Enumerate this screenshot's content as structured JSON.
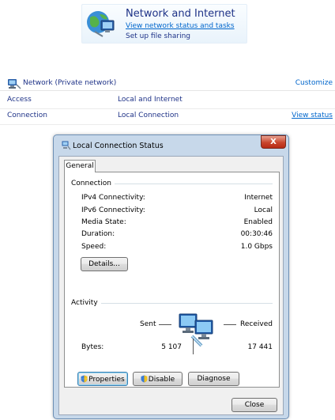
{
  "control_panel": {
    "title": "Network and Internet",
    "link_view_status": "View network status and tasks",
    "link_file_sharing": "Set up file sharing",
    "icon": "network-and-internet-icon"
  },
  "network": {
    "name": "Network (Private network)",
    "customize": "Customize",
    "rows": [
      {
        "key": "Access",
        "value": "Local and Internet"
      },
      {
        "key": "Connection",
        "value": "Local Connection",
        "action": "View status"
      }
    ]
  },
  "dialog": {
    "title": "Local Connection Status",
    "close_label": "X",
    "tab": "General",
    "connection_group": "Connection",
    "connection": [
      {
        "label": "IPv4 Connectivity:",
        "value": "Internet"
      },
      {
        "label": "IPv6 Connectivity:",
        "value": "Local"
      },
      {
        "label": "Media State:",
        "value": "Enabled"
      },
      {
        "label": "Duration:",
        "value": "00:30:46"
      },
      {
        "label": "Speed:",
        "value": "1.0 Gbps"
      }
    ],
    "details_button": "Details...",
    "activity_group": "Activity",
    "sent_label": "Sent",
    "received_label": "Received",
    "bytes_label": "Bytes:",
    "bytes_sent": "5 107",
    "bytes_received": "17 441",
    "properties_button": "Properties",
    "disable_button": "Disable",
    "diagnose_button": "Diagnose",
    "close_button": "Close"
  },
  "colors": {
    "link": "#0066cc",
    "heading": "#1e3287",
    "dialog_frame": "#c7d8ea",
    "close_red": "#c9452c"
  }
}
